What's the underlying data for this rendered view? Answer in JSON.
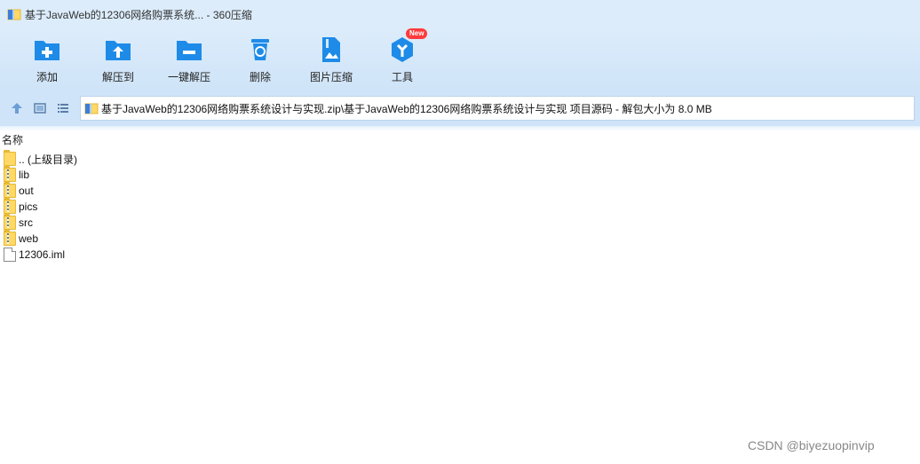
{
  "window": {
    "title": "基于JavaWeb的12306网络购票系统... - 360压缩"
  },
  "toolbar": {
    "items": [
      {
        "label": "添加",
        "icon": "add-folder-icon"
      },
      {
        "label": "解压到",
        "icon": "extract-to-icon"
      },
      {
        "label": "一键解压",
        "icon": "one-click-extract-icon"
      },
      {
        "label": "删除",
        "icon": "delete-trash-icon"
      },
      {
        "label": "图片压缩",
        "icon": "image-compress-icon"
      },
      {
        "label": "工具",
        "icon": "tools-icon",
        "badge": "New"
      }
    ]
  },
  "address_bar": {
    "path": "基于JavaWeb的12306网络购票系统设计与实现.zip\\基于JavaWeb的12306网络购票系统设计与实现 项目源码 - 解包大小为 8.0 MB"
  },
  "file_list": {
    "column_header": "名称",
    "items": [
      {
        "name": ".. (上级目录)",
        "type": "folder"
      },
      {
        "name": "lib",
        "type": "folder"
      },
      {
        "name": "out",
        "type": "folder"
      },
      {
        "name": "pics",
        "type": "folder"
      },
      {
        "name": "src",
        "type": "folder"
      },
      {
        "name": "web",
        "type": "folder"
      },
      {
        "name": "12306.iml",
        "type": "file"
      }
    ]
  },
  "watermark": "CSDN @biyezuopinvip",
  "colors": {
    "accent": "#1e8be8",
    "toolbar_bg": "#dcecfb",
    "badge": "#ff3b3b"
  }
}
